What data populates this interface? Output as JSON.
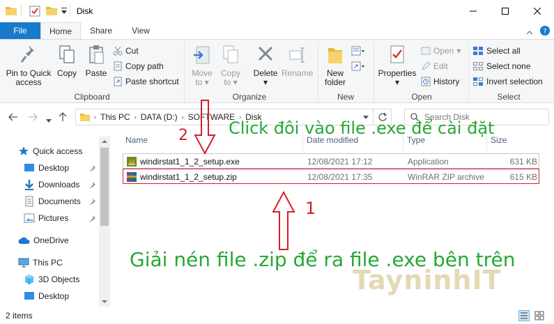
{
  "window": {
    "title": "Disk"
  },
  "ribbon_tabs": {
    "file": "File",
    "home": "Home",
    "share": "Share",
    "view": "View"
  },
  "ribbon": {
    "clipboard": {
      "label": "Clipboard",
      "pin": "Pin to Quick access",
      "copy": "Copy",
      "paste": "Paste",
      "cut": "Cut",
      "copy_path": "Copy path",
      "paste_shortcut": "Paste shortcut"
    },
    "organize": {
      "label": "Organize",
      "move_to": "Move to",
      "copy_to": "Copy to",
      "delete": "Delete",
      "rename": "Rename"
    },
    "new": {
      "label": "New",
      "new_folder": "New folder"
    },
    "open": {
      "label": "Open",
      "properties": "Properties",
      "open": "Open",
      "edit": "Edit",
      "history": "History"
    },
    "select": {
      "label": "Select",
      "select_all": "Select all",
      "select_none": "Select none",
      "invert": "Invert selection"
    }
  },
  "address": {
    "crumbs": [
      "This PC",
      "DATA (D:)",
      "SOFTWARE",
      "Disk"
    ],
    "search_placeholder": "Search Disk"
  },
  "nav_pane": {
    "quick_access": "Quick access",
    "desktop": "Desktop",
    "downloads": "Downloads",
    "documents": "Documents",
    "pictures": "Pictures",
    "onedrive": "OneDrive",
    "this_pc": "This PC",
    "objects_3d": "3D Objects",
    "desktop2": "Desktop"
  },
  "columns": {
    "name": "Name",
    "date": "Date modified",
    "type": "Type",
    "size": "Size"
  },
  "files": [
    {
      "name": "windirstat1_1_2_setup.exe",
      "date": "12/08/2021 17:12",
      "type": "Application",
      "size": "631 KB"
    },
    {
      "name": "windirstat1_1_2_setup.zip",
      "date": "12/08/2021 17:35",
      "type": "WinRAR ZIP archive",
      "size": "615 KB"
    }
  ],
  "status": {
    "count": "2 items"
  },
  "annotations": {
    "top_text": "Click đôi vào file .exe để cài đặt",
    "bottom_text": "Giải nén file .zip để ra file .exe bên trên",
    "num1": "1",
    "num2": "2",
    "watermark": "TayninhIT"
  },
  "colors": {
    "accent": "#1979ca",
    "annotation_green": "#27a736",
    "annotation_red": "#d31f2a"
  }
}
